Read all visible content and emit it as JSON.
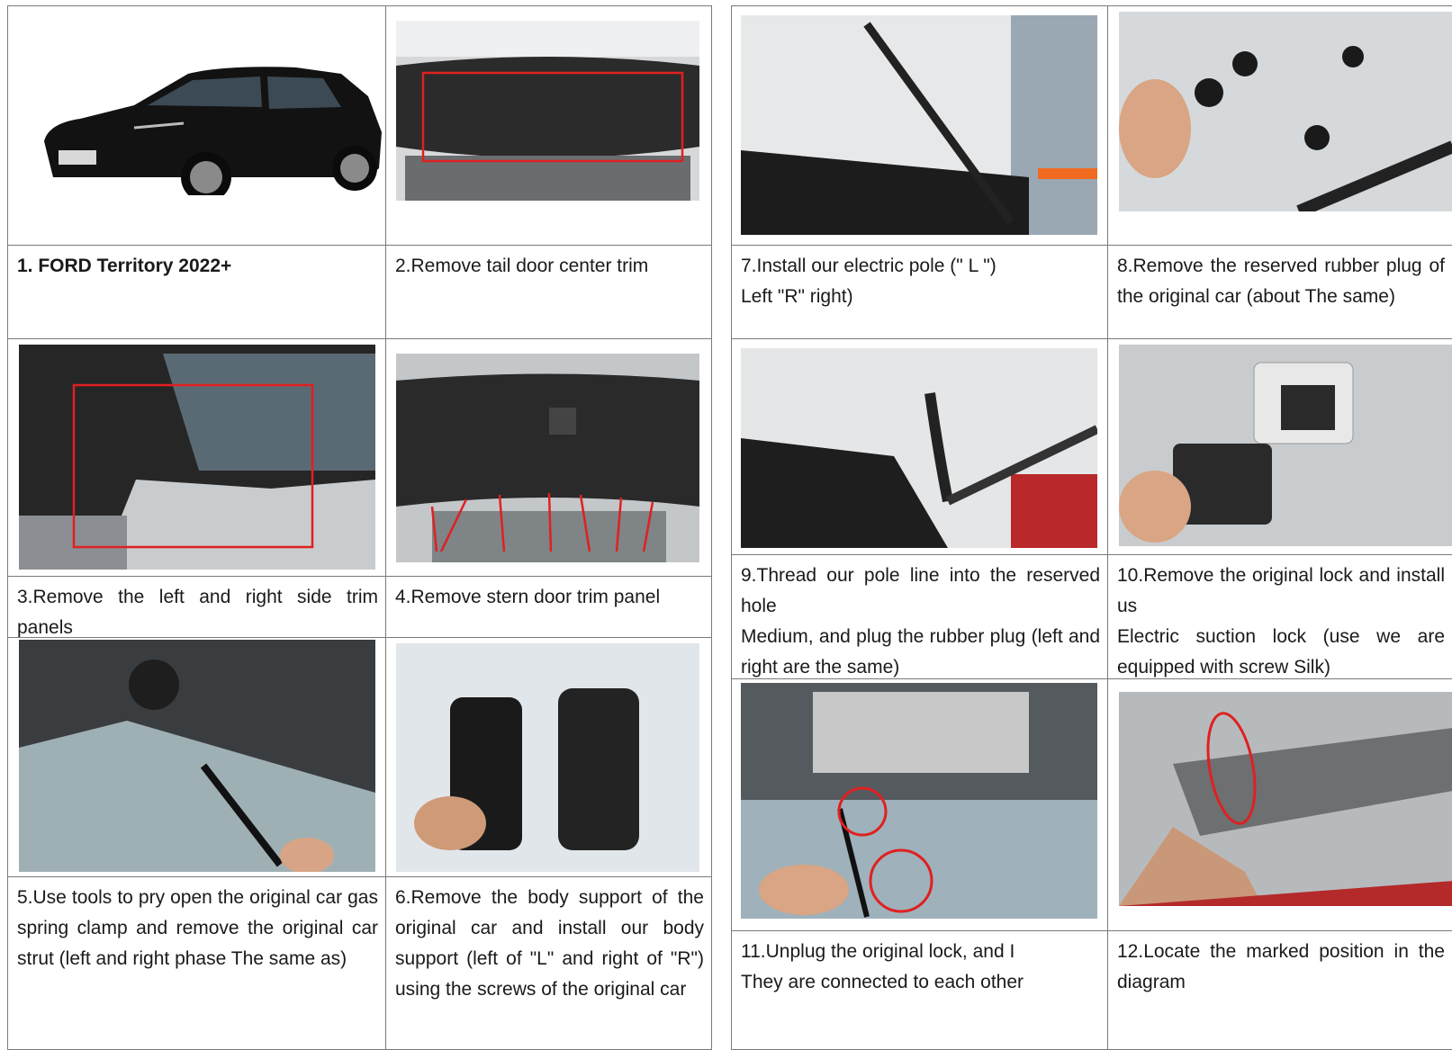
{
  "steps": [
    {
      "caption": "1.  FORD Territory 2022+"
    },
    {
      "caption": "2.Remove tail door center trim"
    },
    {
      "caption": "3.Remove the left and right side trim panels"
    },
    {
      "caption": "4.Remove stern door trim panel"
    },
    {
      "caption": "5.Use tools to pry open the original car gas spring clamp and remove the original car strut (left and right phase The same as)"
    },
    {
      "caption": "6.Remove the body support of the original car and install our body support (left of \"L\" and right of \"R\") using the screws of the original car"
    },
    {
      "caption": "7.Install our electric pole (\" L \")\nLeft \"R\" right)"
    },
    {
      "caption": "8.Remove the reserved rubber plug of the original car (about The same)"
    },
    {
      "caption": "9.Thread our pole line into the reserved hole\nMedium, and plug the rubber plug (left and right are the same)"
    },
    {
      "caption": "10.Remove the original lock and install us\nElectric suction lock (use we are equipped with screw Silk)"
    },
    {
      "caption": "11.Unplug the original lock, and I\nThey are connected to each other"
    },
    {
      "caption": "12.Locate the marked position in the diagram"
    }
  ],
  "colors": {
    "border": "#7a7a7a",
    "highlight": "#e02020"
  }
}
